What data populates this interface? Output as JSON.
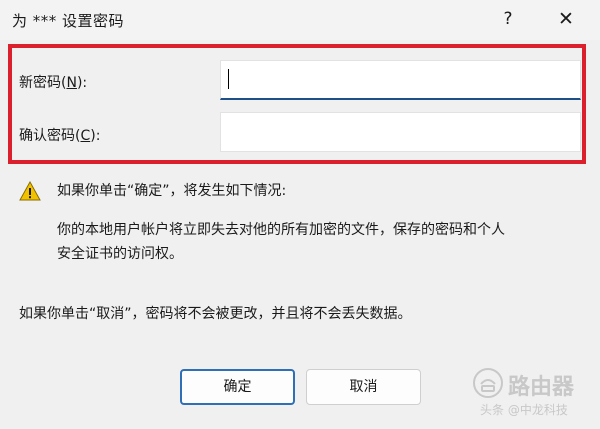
{
  "dialog": {
    "title": "为 ***    设置密码",
    "help_glyph": "?",
    "close_glyph": "✕"
  },
  "fields": {
    "new_password": {
      "label_pre": "新密码(",
      "mnemonic": "N",
      "label_post": "):",
      "value": ""
    },
    "confirm_password": {
      "label_pre": "确认密码(",
      "mnemonic": "C",
      "label_post": "):",
      "value": ""
    }
  },
  "warning": {
    "icon": "warning-triangle-icon",
    "heading": "如果你单击“确定”，将发生如下情况:",
    "line1": "你的本地用户帐户将立即失去对他的所有加密的文件，保存的密码和个人",
    "line2": "安全证书的访问权。"
  },
  "cancel_note": "如果你单击“取消”，密码将不会被更改，并且将不会丢失数据。",
  "buttons": {
    "ok": "确定",
    "cancel": "取消"
  },
  "watermark": {
    "brand": "路由器",
    "credit": "头条 @中龙科技"
  },
  "colors": {
    "highlight": "#dc1f2d",
    "focus": "#1f4f87",
    "default_button": "#2f6fb5",
    "warning": "#f2c200"
  }
}
